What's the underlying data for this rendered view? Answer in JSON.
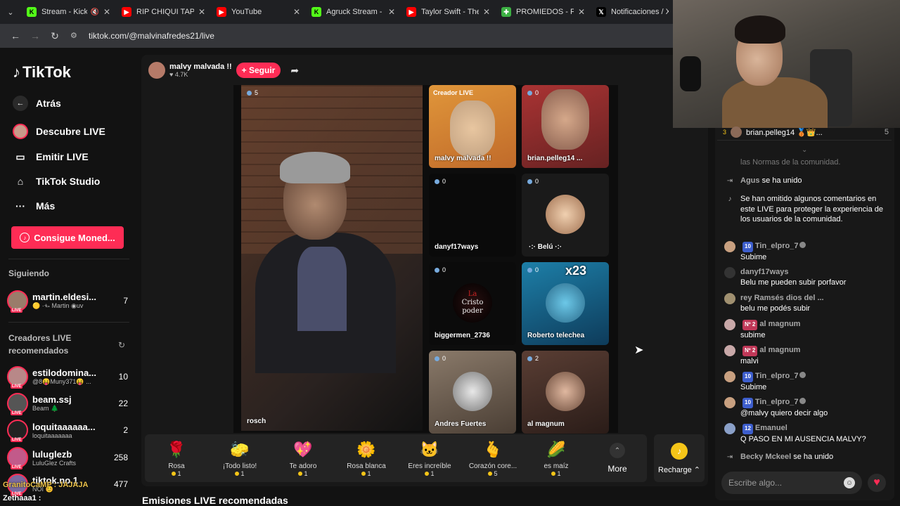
{
  "browser": {
    "tabs": [
      {
        "title": "Stream - Kick",
        "icon": "kick-icon",
        "color": "#53fc18",
        "glyph": "K",
        "muted": true,
        "active": false
      },
      {
        "title": "RIP CHIQUI TAPIA",
        "icon": "youtube-icon",
        "color": "#ff0000",
        "glyph": "▶",
        "active": false
      },
      {
        "title": "YouTube",
        "icon": "youtube-icon",
        "color": "#ff0000",
        "glyph": "▶",
        "active": false
      },
      {
        "title": "Agruck Stream - V",
        "icon": "kick-icon",
        "color": "#53fc18",
        "glyph": "K",
        "active": false
      },
      {
        "title": "Taylor Swift - The",
        "icon": "youtube-icon",
        "color": "#ff0000",
        "glyph": "▶",
        "active": false
      },
      {
        "title": "PROMIEDOS - Fut",
        "icon": "promiedos-icon",
        "color": "#3cb043",
        "glyph": "✚",
        "active": false
      },
      {
        "title": "Notificaciones / X",
        "icon": "x-icon",
        "color": "#000000",
        "glyph": "𝕏",
        "active": false
      }
    ],
    "url": "tiktok.com/@malvinafredes21/live"
  },
  "sidebar": {
    "logo": "TikTok",
    "nav": [
      {
        "label": "Atrás",
        "icon": "back-arrow-icon"
      },
      {
        "label": "Descubre LIVE",
        "icon": "live-avatar-icon"
      },
      {
        "label": "Emitir LIVE",
        "icon": "camera-icon"
      },
      {
        "label": "TikTok Studio",
        "icon": "studio-icon"
      },
      {
        "label": "Más",
        "icon": "more-dots-icon"
      }
    ],
    "coins_button": "Consigue Moned...",
    "following_heading": "Siguiendo",
    "following": [
      {
        "name": "martin.eldesi...",
        "sub": "🟡 ·+̶·  Martin ◉uv",
        "count": "7"
      }
    ],
    "recommended_heading": "Creadores LIVE recomendados",
    "recommended": [
      {
        "name": "estilodomina...",
        "sub": "@8😝Muny371😝 ...",
        "count": "10"
      },
      {
        "name": "beam.ssj",
        "sub": "Beam 🌲",
        "count": "22"
      },
      {
        "name": "loquitaaaaaa...",
        "sub": "loquitaaaaaaa",
        "count": "2"
      },
      {
        "name": "luluglezb",
        "sub": "LuluGlez Crafts",
        "count": "258"
      },
      {
        "name": "tiktok.no.1",
        "sub": "NOI 😊",
        "count": "477"
      }
    ],
    "overlay_1": "GranitoCaMP : JAJAJA",
    "overlay_2": "Zethaaa1 :"
  },
  "live": {
    "host_name": "malvy malvada !!",
    "likes": "♥ 4.7K",
    "follow": "+ Seguir",
    "main": {
      "name": "rosch",
      "viewers": "5"
    },
    "tiles": [
      {
        "name": "malvy malvada !!",
        "viewers": "",
        "tag": "Creador LIVE"
      },
      {
        "name": "brian.pelleg14 ...",
        "viewers": "0",
        "tag": ""
      },
      {
        "name": "danyf17ways",
        "viewers": "0",
        "tag": ""
      },
      {
        "name": "·:· Belú ·:·",
        "viewers": "0",
        "tag": ""
      },
      {
        "name": "biggermen_2736",
        "viewers": "0",
        "tag": ""
      },
      {
        "name": "Roberto telechea",
        "viewers": "0",
        "tag": "x23"
      },
      {
        "name": "Andres Fuertes",
        "viewers": "0",
        "tag": ""
      },
      {
        "name": "al magnum",
        "viewers": "2",
        "tag": ""
      }
    ],
    "tile_art": {
      "cristo_line1": "La",
      "cristo_line2": "Cristo",
      "cristo_line3": "poder"
    },
    "gifts": [
      {
        "name": "Rosa",
        "price": "1",
        "icon": "🌹"
      },
      {
        "name": "¡Todo listo!",
        "price": "1",
        "icon": "🧽"
      },
      {
        "name": "Te adoro",
        "price": "1",
        "icon": "💖"
      },
      {
        "name": "Rosa blanca",
        "price": "1",
        "icon": "🌼"
      },
      {
        "name": "Eres increíble",
        "price": "1",
        "icon": "🐱"
      },
      {
        "name": "Corazón core...",
        "price": "5",
        "icon": "🫰"
      },
      {
        "name": "es maíz",
        "price": "1",
        "icon": "🌽"
      }
    ],
    "more": "More",
    "recharge": "Recharge ⌃"
  },
  "recommended_lives_title": "Emisiones LIVE recomendadas",
  "chat": {
    "top_viewer": {
      "rank": "3",
      "name": "brian.pelleg14 🥉👑...",
      "count": "5"
    },
    "partial_text": "las Normas de la comunidad.",
    "messages": [
      {
        "user": "Agus",
        "text": "se ha unido",
        "type": "join"
      },
      {
        "user": "",
        "text": "Se han omitido algunos comentarios en este LIVE para proteger la experiencia de los usuarios de la comunidad.",
        "type": "system"
      },
      {
        "user": "Tin_elpro_7",
        "level": "10",
        "text": "Subime",
        "type": "msg"
      },
      {
        "user": "danyf17ways",
        "level": "",
        "text": "Belu me pueden subir porfavor",
        "type": "msg"
      },
      {
        "user": "rey Ramsés dios del ...",
        "level": "",
        "text": "belu me podés subir",
        "type": "msg"
      },
      {
        "user": "al magnum",
        "level": "Nº 2",
        "text": "subime",
        "type": "msg"
      },
      {
        "user": "al magnum",
        "level": "Nº 2",
        "text": "malvi",
        "type": "msg"
      },
      {
        "user": "Tin_elpro_7",
        "level": "10",
        "text": "Subime",
        "type": "msg"
      },
      {
        "user": "Tin_elpro_7",
        "level": "10",
        "text": "@malvy quiero decir algo",
        "type": "msg"
      },
      {
        "user": "Emanuel",
        "level": "12",
        "text": "Q PASO EN MI AUSENCIA MALVY?",
        "type": "msg"
      },
      {
        "user": "Becky Mckeel",
        "text": "se ha unido",
        "type": "join"
      }
    ],
    "input_placeholder": "Escribe algo..."
  },
  "colors": {
    "accent": "#fe2c55",
    "coin": "#f5c518",
    "level_badge": "#3d5ecc"
  }
}
